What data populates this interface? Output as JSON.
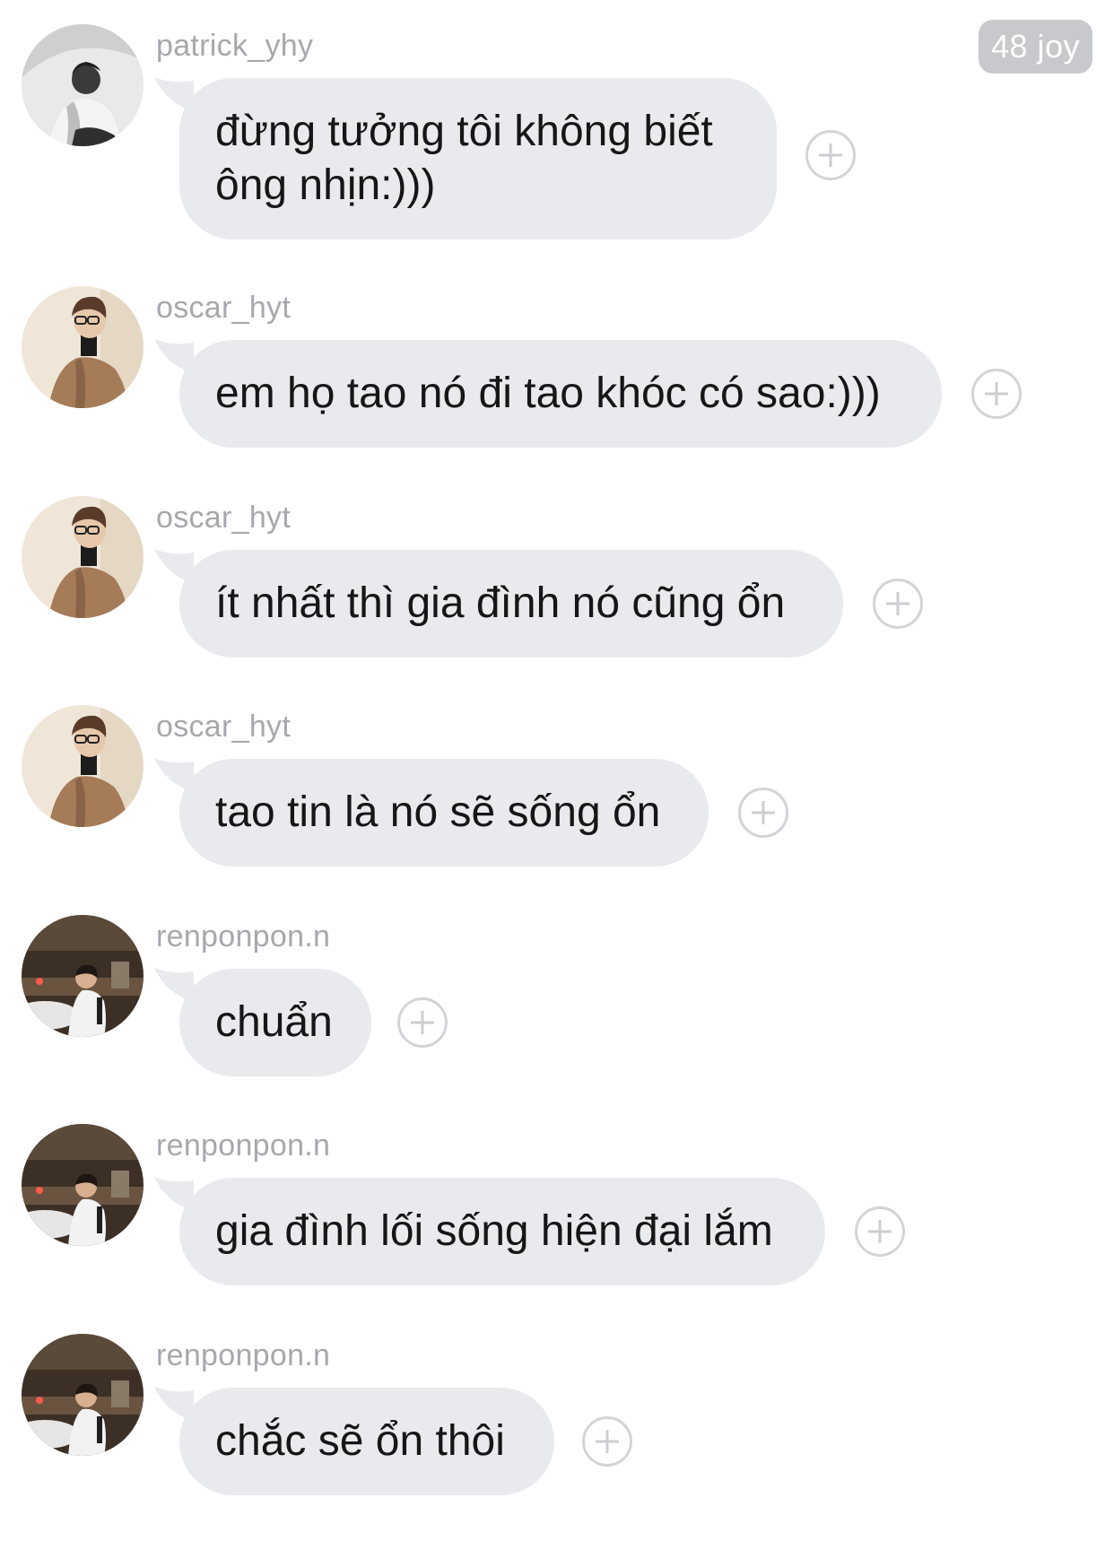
{
  "header": {
    "reaction_badge": "48 joy"
  },
  "messages": [
    {
      "username": "patrick_yhy",
      "text": "đừng tưởng tôi không biết ông nhịn:)))",
      "avatar": "patrick-avatar"
    },
    {
      "username": "oscar_hyt",
      "text": "em họ tao nó đi tao khóc có sao:)))",
      "avatar": "oscar-avatar"
    },
    {
      "username": "oscar_hyt",
      "text": "ít nhất thì gia đình nó cũng ổn",
      "avatar": "oscar-avatar"
    },
    {
      "username": "oscar_hyt",
      "text": "tao tin là nó sẽ sống ổn",
      "avatar": "oscar-avatar"
    },
    {
      "username": "renponpon.n",
      "text": "chuẩn",
      "avatar": "renponpon-avatar"
    },
    {
      "username": "renponpon.n",
      "text": "gia đình lối sống hiện đại lắm",
      "avatar": "renponpon-avatar"
    },
    {
      "username": "renponpon.n",
      "text": "chắc sẽ ổn thôi",
      "avatar": "renponpon-avatar"
    }
  ],
  "colors": {
    "bubble": "#e8eaed",
    "username": "#a6a8ad",
    "badge": "#c8c9cc",
    "text": "#161616"
  },
  "icons": {
    "add_reaction": "plus-circle-icon"
  }
}
